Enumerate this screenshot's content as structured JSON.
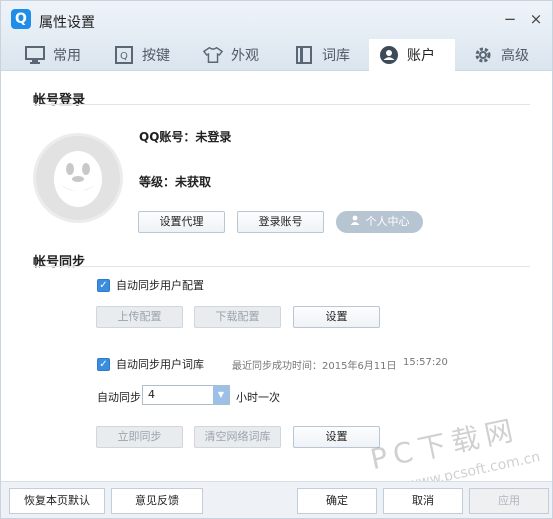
{
  "window": {
    "title": "属性设置",
    "logo_letter": "Q",
    "minimize": "−",
    "close": "×"
  },
  "tabs": [
    {
      "label": "常用",
      "icon": "monitor-icon"
    },
    {
      "label": "按键",
      "icon": "key-icon"
    },
    {
      "label": "外观",
      "icon": "shirt-icon"
    },
    {
      "label": "词库",
      "icon": "book-icon"
    },
    {
      "label": "账户",
      "icon": "user-icon",
      "active": true
    },
    {
      "label": "高级",
      "icon": "gear-icon"
    }
  ],
  "account_login": {
    "title": "帐号登录",
    "qq_account": "QQ账号：未登录",
    "level": "等级：未获取",
    "proxy_button": "设置代理",
    "login_button": "登录账号",
    "personal_center": "个人中心"
  },
  "account_sync": {
    "title": "帐号同步",
    "sync_config": {
      "label": "自动同步用户配置",
      "checked": true
    },
    "upload_config": "上传配置",
    "download_config": "下载配置",
    "settings_1": "设置",
    "sync_dict": {
      "label": "自动同步用户词库",
      "checked": true
    },
    "last_sync": "最近同步成功时间：2015年6月11日",
    "last_sync_time": "15:57:20",
    "auto_sync_label": "自动同步",
    "interval_value": "4",
    "interval_unit": "小时一次",
    "sync_now": "立即同步",
    "clear_cloud": "清空网络词库",
    "settings_2": "设置"
  },
  "footer": {
    "restore_defaults": "恢复本页默认",
    "feedback": "意见反馈",
    "ok": "确定",
    "cancel": "取消",
    "apply": "应用"
  },
  "watermark": {
    "main": "PC下载网",
    "sub": "www.pcsoft.com.cn"
  },
  "colors": {
    "accent": "#3b8de0",
    "tab_bar": "#dfe7f0",
    "pill": "#b7c4d1"
  }
}
